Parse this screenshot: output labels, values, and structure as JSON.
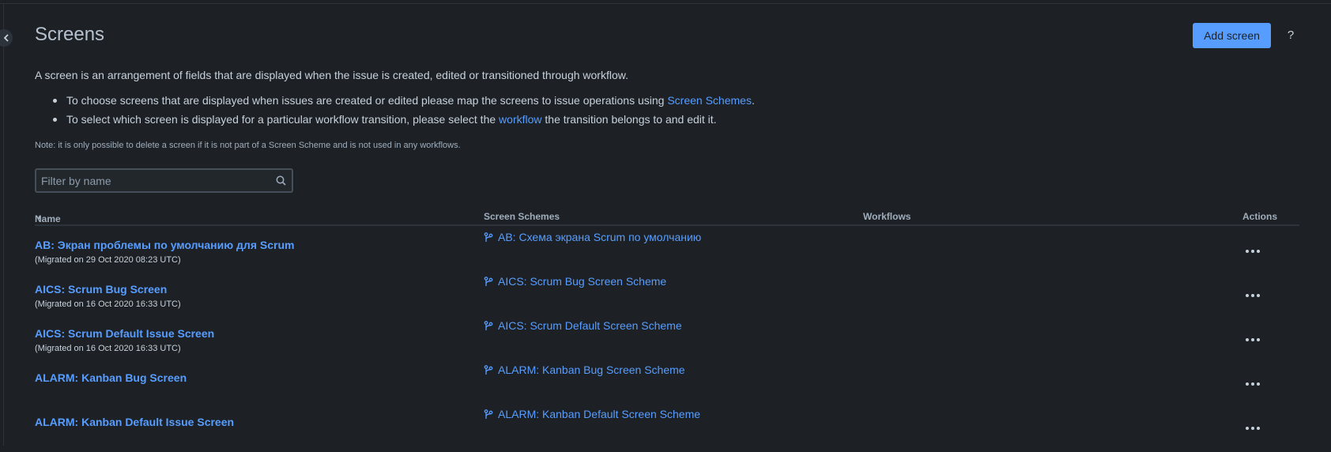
{
  "header": {
    "title": "Screens",
    "add_button": "Add screen",
    "help_label": "?"
  },
  "intro": {
    "text": "A screen is an arrangement of fields that are displayed when the issue is created, edited or transitioned through workflow.",
    "bullet1_pre": "To choose screens that are displayed when issues are created or edited please map the screens to issue operations using ",
    "bullet1_link": "Screen Schemes",
    "bullet1_post": ".",
    "bullet2_pre": "To select which screen is displayed for a particular workflow transition, please select the ",
    "bullet2_link": "workflow",
    "bullet2_post": " the transition belongs to and edit it.",
    "note": "Note: it is only possible to delete a screen if it is not part of a Screen Scheme and is not used in any workflows."
  },
  "filter": {
    "placeholder": "Filter by name",
    "value": ""
  },
  "table": {
    "columns": {
      "name": "Name",
      "schemes": "Screen Schemes",
      "workflows": "Workflows",
      "actions": "Actions"
    },
    "rows": [
      {
        "name": "AB: Экран проблемы по умолчанию для Scrum",
        "migrated": "(Migrated on 29 Oct 2020 08:23 UTC)",
        "scheme": "AB: Схема экрана Scrum по умолчанию"
      },
      {
        "name": "AICS: Scrum Bug Screen",
        "migrated": "(Migrated on 16 Oct 2020 16:33 UTC)",
        "scheme": "AICS: Scrum Bug Screen Scheme"
      },
      {
        "name": "AICS: Scrum Default Issue Screen",
        "migrated": "(Migrated on 16 Oct 2020 16:33 UTC)",
        "scheme": "AICS: Scrum Default Screen Scheme"
      },
      {
        "name": "ALARM: Kanban Bug Screen",
        "migrated": "",
        "scheme": "ALARM: Kanban Bug Screen Scheme"
      },
      {
        "name": "ALARM: Kanban Default Issue Screen",
        "migrated": "",
        "scheme": "ALARM: Kanban Default Screen Scheme"
      }
    ]
  },
  "colors": {
    "background": "#1d2125",
    "link": "#579dff",
    "primary_button": "#579dff",
    "text": "#c7d1db"
  }
}
